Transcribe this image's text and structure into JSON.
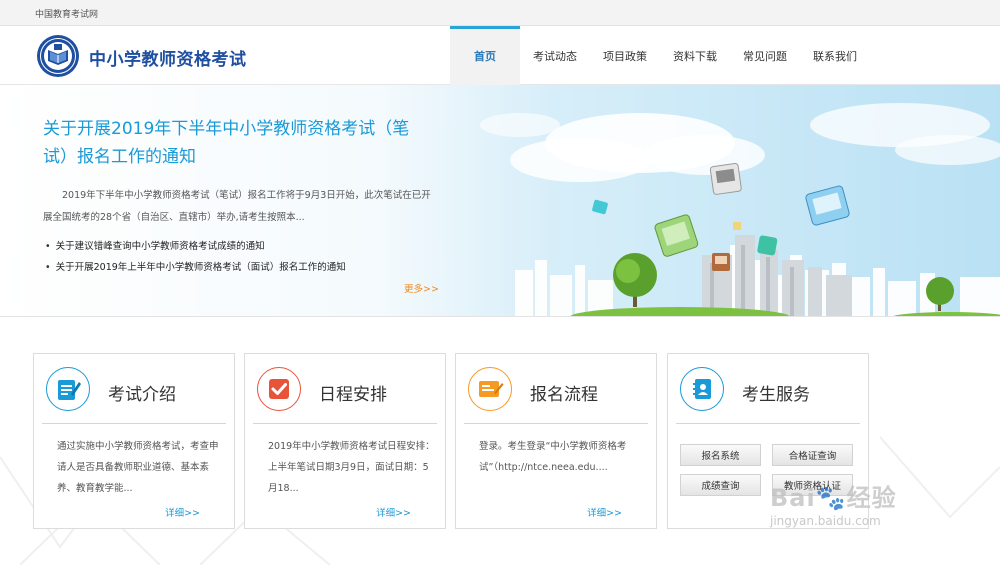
{
  "topbar": {
    "site_name": "中国教育考试网"
  },
  "header": {
    "brand": "中小学教师资格考试",
    "nav": [
      {
        "label": "首页",
        "active": true
      },
      {
        "label": "考试动态",
        "active": false
      },
      {
        "label": "项目政策",
        "active": false
      },
      {
        "label": "资料下载",
        "active": false
      },
      {
        "label": "常见问题",
        "active": false
      },
      {
        "label": "联系我们",
        "active": false
      }
    ]
  },
  "banner": {
    "title": "关于开展2019年下半年中小学教师资格考试（笔试）报名工作的通知",
    "desc": "2019年下半年中小学教师资格考试（笔试）报名工作将于9月3日开始，此次笔试在已开展全国统考的28个省（自治区、直辖市）举办,请考生按照本...",
    "links": [
      "关于建议错峰查询中小学教师资格考试成绩的通知",
      "关于开展2019年上半年中小学教师资格考试（面试）报名工作的通知"
    ],
    "more": "更多>>"
  },
  "cards": [
    {
      "title": "考试介绍",
      "icon": "document-pen-icon",
      "text": "通过实施中小学教师资格考试，考查申请人是否具备教师职业道德、基本素养、教育教学能...",
      "link": "详细>>"
    },
    {
      "title": "日程安排",
      "icon": "checkmark-icon",
      "text": "2019年中小学教师资格考试日程安排：上半年笔试日期3月9日，面试日期：5月18...",
      "link": "详细>>"
    },
    {
      "title": "报名流程",
      "icon": "form-pen-icon",
      "text": "登录。考生登录“中小学教师资格考试”（http://ntce.neea.edu....",
      "link": "详细>>"
    },
    {
      "title": "考生服务",
      "icon": "contact-book-icon",
      "buttons": [
        "报名系统",
        "合格证查询",
        "成绩查询",
        "教师资格认证"
      ]
    }
  ],
  "watermark": {
    "brand": "Bai",
    "brand2": "经验",
    "url": "jingyan.baidu.com"
  },
  "colors": {
    "accent": "#1a9ad6",
    "brand": "#1f4fa0",
    "more": "#f08a1c",
    "check": "#e8543a",
    "orange": "#f59a23"
  }
}
